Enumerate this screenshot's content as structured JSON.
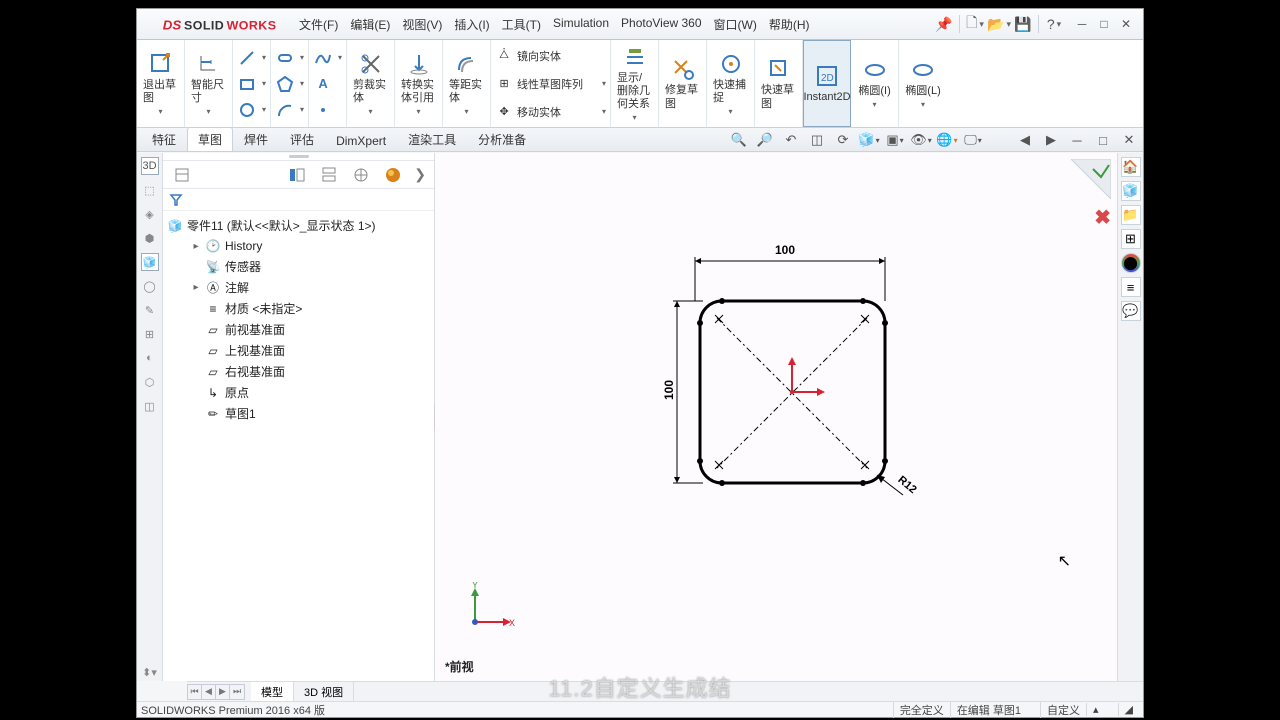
{
  "title": {
    "logo_text": "SOLIDWORKS"
  },
  "menu": {
    "file": "文件(F)",
    "edit": "编辑(E)",
    "view": "视图(V)",
    "insert": "插入(I)",
    "tools": "工具(T)",
    "simulation": "Simulation",
    "photoview": "PhotoView 360",
    "window": "窗口(W)",
    "help": "帮助(H)"
  },
  "ribbon": {
    "exit_sketch": "退出草图",
    "smart_dim": "智能尺寸",
    "trim": "剪裁实体",
    "convert": "转换实体引用",
    "offset": "等距实体",
    "mirror": "镜向实体",
    "linear_pattern": "线性草图阵列",
    "move": "移动实体",
    "show_hide": "显示/删除几何关系",
    "repair": "修复草图",
    "quick_snap": "快速捕捉",
    "rapid_sketch": "快速草图",
    "instant2d": "Instant2D",
    "ellipse": "椭圆(I)",
    "ellipse2": "椭圆(L)"
  },
  "tabs": {
    "feature": "特征",
    "sketch": "草图",
    "weld": "焊件",
    "eval": "评估",
    "dimxpert": "DimXpert",
    "render": "渲染工具",
    "analysis": "分析准备"
  },
  "tree": {
    "root": "零件11  (默认<<默认>_显示状态 1>)",
    "history": "History",
    "sensors": "传感器",
    "annotations": "注解",
    "material": "材质 <未指定>",
    "front_plane": "前视基准面",
    "top_plane": "上视基准面",
    "right_plane": "右视基准面",
    "origin": "原点",
    "sketch1": "草图1"
  },
  "sketch": {
    "dim_100_h": "100",
    "dim_100_v": "100",
    "dim_r12": "R12",
    "view_label": "*前视"
  },
  "bottom_tabs": {
    "model": "模型",
    "3dview": "3D 视图"
  },
  "status": {
    "product": "SOLIDWORKS Premium 2016 x64 版",
    "fully_defined": "完全定义",
    "editing": "在编辑 草图1",
    "custom": "自定义"
  },
  "subtitle": "11.2自定义生成结",
  "chart_data": {
    "type": "diagram",
    "description": "2D sketch: rounded square, 100x100, corner fillet R12, centered on origin",
    "width": 100,
    "height": 100,
    "corner_radius": 12
  }
}
